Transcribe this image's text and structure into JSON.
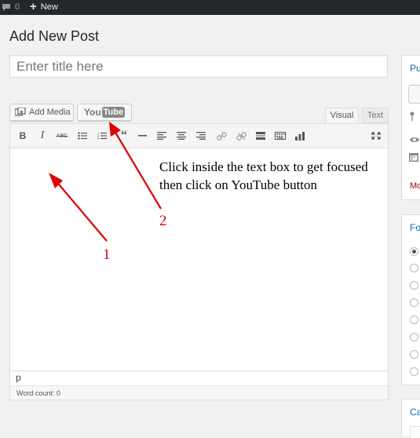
{
  "admin_bar": {
    "comments_count": "0",
    "new_label": "New"
  },
  "page": {
    "title": "Add New Post"
  },
  "title_field": {
    "placeholder": "Enter title here"
  },
  "media": {
    "add_media_label": "Add Media",
    "youtube_you": "You",
    "youtube_tube": "Tube"
  },
  "tabs": {
    "visual": "Visual",
    "text": "Text"
  },
  "toolbar": {
    "buttons": [
      "bold-icon",
      "italic-icon",
      "strikethrough-icon",
      "bulleted-list-icon",
      "numbered-list-icon",
      "blockquote-icon",
      "horizontal-line-icon",
      "align-left-icon",
      "align-center-icon",
      "align-right-icon",
      "link-icon",
      "unlink-icon",
      "read-more-icon",
      "toolbar-toggle-icon",
      "insert-chart-icon",
      "fullscreen-icon"
    ]
  },
  "editor": {
    "path": "p",
    "word_count": "Word count: 0"
  },
  "annotation": {
    "instructions": "Click inside the text box to get focused then click on YouTube button",
    "label_1": "1",
    "label_2": "2",
    "color": "#dd0000"
  },
  "sidebar": {
    "publish_initial": "Pu",
    "format_initial": "Fo",
    "categories_initial": "Ca",
    "move_initial": "Mo"
  }
}
